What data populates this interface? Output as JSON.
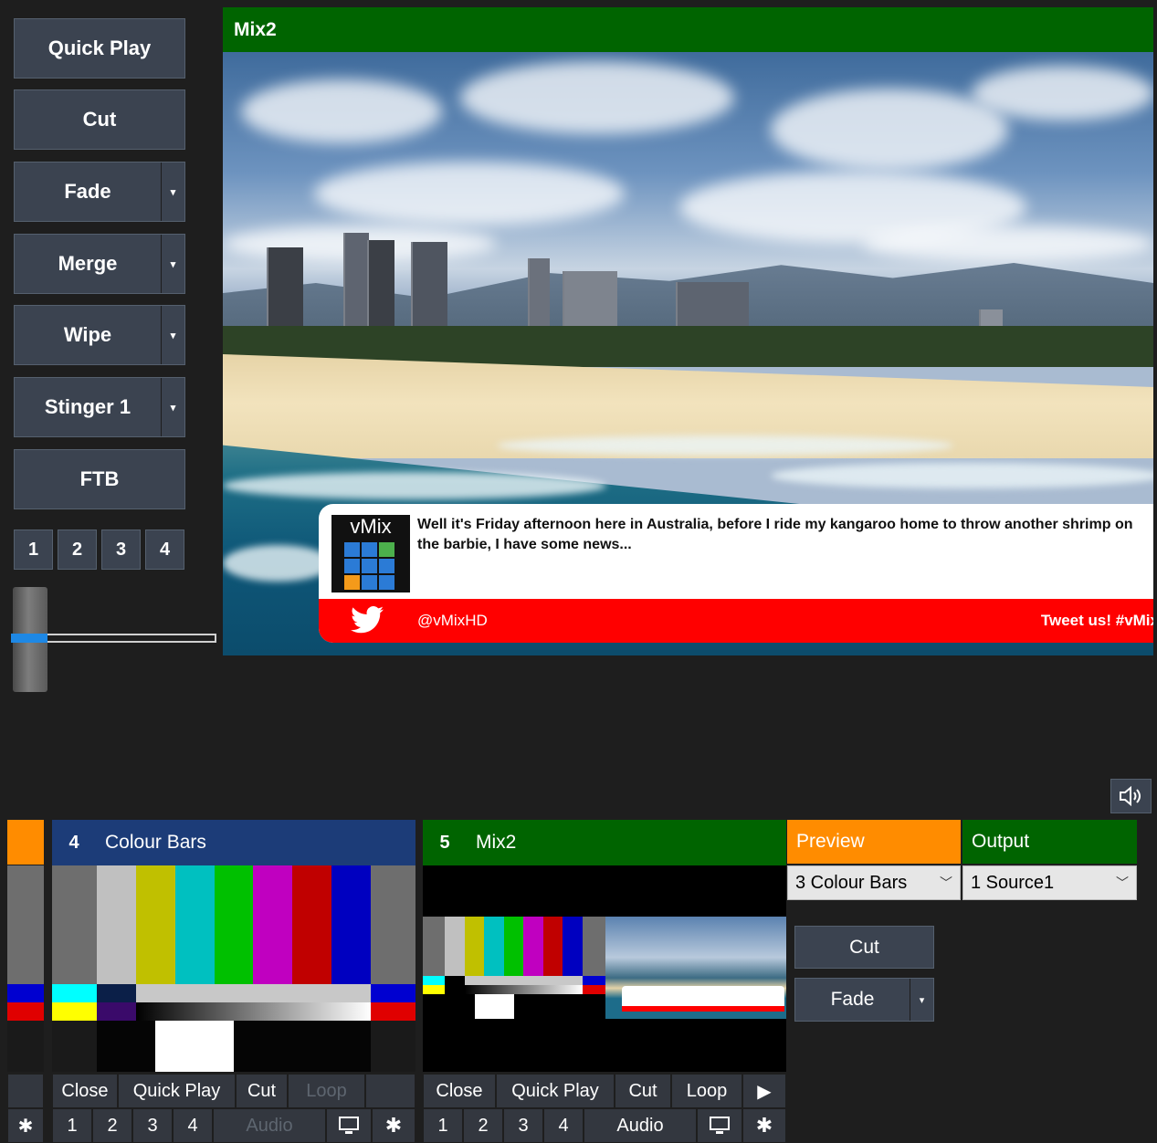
{
  "transitions": {
    "quick_play": "Quick Play",
    "cut": "Cut",
    "fade": "Fade",
    "merge": "Merge",
    "wipe": "Wipe",
    "stinger": "Stinger 1",
    "ftb": "FTB",
    "numbers": [
      "1",
      "2",
      "3",
      "4"
    ],
    "dropdown_glyph": "▾"
  },
  "preview": {
    "title": "Mix2",
    "title_bar_color": "#006400",
    "tweet": {
      "logo_text": "vMix",
      "text": "Well it's Friday afternoon here in Australia, before I ride my kangaroo home to throw another shrimp on the barbie, I have some news...",
      "handle": "@vMixHD",
      "cta": "Tweet us! #vMix",
      "bar_color": "#ff0000"
    }
  },
  "inputs": [
    {
      "number": "4",
      "title": "Colour Bars",
      "header_color": "#1c3c78",
      "buttons": [
        "Close",
        "Quick Play",
        "Cut",
        "Loop"
      ],
      "numbers": [
        "1",
        "2",
        "3",
        "4"
      ],
      "audio": "Audio"
    },
    {
      "number": "5",
      "title": "Mix2",
      "header_color": "#006400",
      "buttons": [
        "Close",
        "Quick Play",
        "Cut",
        "Loop"
      ],
      "numbers": [
        "1",
        "2",
        "3",
        "4"
      ],
      "audio": "Audio",
      "play": "▶"
    }
  ],
  "mix": {
    "preview_label": "Preview",
    "preview_color": "#ff8c00",
    "output_label": "Output",
    "output_color": "#006400",
    "preview_value": "3 Colour Bars",
    "output_value": "1 Source1",
    "cut": "Cut",
    "fade": "Fade",
    "dropdown_glyph": "▾",
    "chevron": "﹀"
  },
  "icons": {
    "gear": "✱",
    "speaker": "🔊"
  },
  "colour_bars": [
    "#c0c0c0",
    "#c0c000",
    "#00c0c0",
    "#00c000",
    "#c000c0",
    "#c00000",
    "#0000c0"
  ]
}
